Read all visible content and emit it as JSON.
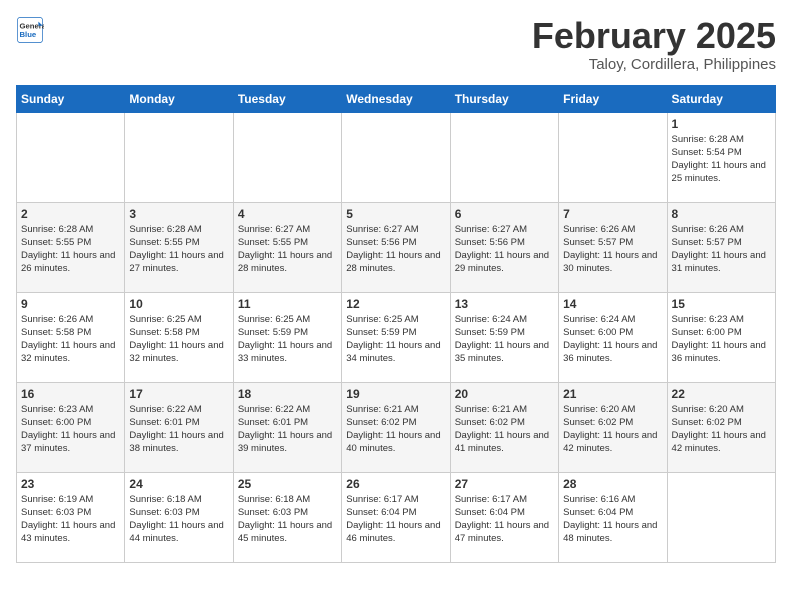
{
  "logo": {
    "line1": "General",
    "line2": "Blue"
  },
  "title": "February 2025",
  "subtitle": "Taloy, Cordillera, Philippines",
  "weekdays": [
    "Sunday",
    "Monday",
    "Tuesday",
    "Wednesday",
    "Thursday",
    "Friday",
    "Saturday"
  ],
  "weeks": [
    [
      {
        "day": "",
        "info": ""
      },
      {
        "day": "",
        "info": ""
      },
      {
        "day": "",
        "info": ""
      },
      {
        "day": "",
        "info": ""
      },
      {
        "day": "",
        "info": ""
      },
      {
        "day": "",
        "info": ""
      },
      {
        "day": "1",
        "info": "Sunrise: 6:28 AM\nSunset: 5:54 PM\nDaylight: 11 hours and 25 minutes."
      }
    ],
    [
      {
        "day": "2",
        "info": "Sunrise: 6:28 AM\nSunset: 5:55 PM\nDaylight: 11 hours and 26 minutes."
      },
      {
        "day": "3",
        "info": "Sunrise: 6:28 AM\nSunset: 5:55 PM\nDaylight: 11 hours and 27 minutes."
      },
      {
        "day": "4",
        "info": "Sunrise: 6:27 AM\nSunset: 5:55 PM\nDaylight: 11 hours and 28 minutes."
      },
      {
        "day": "5",
        "info": "Sunrise: 6:27 AM\nSunset: 5:56 PM\nDaylight: 11 hours and 28 minutes."
      },
      {
        "day": "6",
        "info": "Sunrise: 6:27 AM\nSunset: 5:56 PM\nDaylight: 11 hours and 29 minutes."
      },
      {
        "day": "7",
        "info": "Sunrise: 6:26 AM\nSunset: 5:57 PM\nDaylight: 11 hours and 30 minutes."
      },
      {
        "day": "8",
        "info": "Sunrise: 6:26 AM\nSunset: 5:57 PM\nDaylight: 11 hours and 31 minutes."
      }
    ],
    [
      {
        "day": "9",
        "info": "Sunrise: 6:26 AM\nSunset: 5:58 PM\nDaylight: 11 hours and 32 minutes."
      },
      {
        "day": "10",
        "info": "Sunrise: 6:25 AM\nSunset: 5:58 PM\nDaylight: 11 hours and 32 minutes."
      },
      {
        "day": "11",
        "info": "Sunrise: 6:25 AM\nSunset: 5:59 PM\nDaylight: 11 hours and 33 minutes."
      },
      {
        "day": "12",
        "info": "Sunrise: 6:25 AM\nSunset: 5:59 PM\nDaylight: 11 hours and 34 minutes."
      },
      {
        "day": "13",
        "info": "Sunrise: 6:24 AM\nSunset: 5:59 PM\nDaylight: 11 hours and 35 minutes."
      },
      {
        "day": "14",
        "info": "Sunrise: 6:24 AM\nSunset: 6:00 PM\nDaylight: 11 hours and 36 minutes."
      },
      {
        "day": "15",
        "info": "Sunrise: 6:23 AM\nSunset: 6:00 PM\nDaylight: 11 hours and 36 minutes."
      }
    ],
    [
      {
        "day": "16",
        "info": "Sunrise: 6:23 AM\nSunset: 6:00 PM\nDaylight: 11 hours and 37 minutes."
      },
      {
        "day": "17",
        "info": "Sunrise: 6:22 AM\nSunset: 6:01 PM\nDaylight: 11 hours and 38 minutes."
      },
      {
        "day": "18",
        "info": "Sunrise: 6:22 AM\nSunset: 6:01 PM\nDaylight: 11 hours and 39 minutes."
      },
      {
        "day": "19",
        "info": "Sunrise: 6:21 AM\nSunset: 6:02 PM\nDaylight: 11 hours and 40 minutes."
      },
      {
        "day": "20",
        "info": "Sunrise: 6:21 AM\nSunset: 6:02 PM\nDaylight: 11 hours and 41 minutes."
      },
      {
        "day": "21",
        "info": "Sunrise: 6:20 AM\nSunset: 6:02 PM\nDaylight: 11 hours and 42 minutes."
      },
      {
        "day": "22",
        "info": "Sunrise: 6:20 AM\nSunset: 6:02 PM\nDaylight: 11 hours and 42 minutes."
      }
    ],
    [
      {
        "day": "23",
        "info": "Sunrise: 6:19 AM\nSunset: 6:03 PM\nDaylight: 11 hours and 43 minutes."
      },
      {
        "day": "24",
        "info": "Sunrise: 6:18 AM\nSunset: 6:03 PM\nDaylight: 11 hours and 44 minutes."
      },
      {
        "day": "25",
        "info": "Sunrise: 6:18 AM\nSunset: 6:03 PM\nDaylight: 11 hours and 45 minutes."
      },
      {
        "day": "26",
        "info": "Sunrise: 6:17 AM\nSunset: 6:04 PM\nDaylight: 11 hours and 46 minutes."
      },
      {
        "day": "27",
        "info": "Sunrise: 6:17 AM\nSunset: 6:04 PM\nDaylight: 11 hours and 47 minutes."
      },
      {
        "day": "28",
        "info": "Sunrise: 6:16 AM\nSunset: 6:04 PM\nDaylight: 11 hours and 48 minutes."
      },
      {
        "day": "",
        "info": ""
      }
    ]
  ]
}
